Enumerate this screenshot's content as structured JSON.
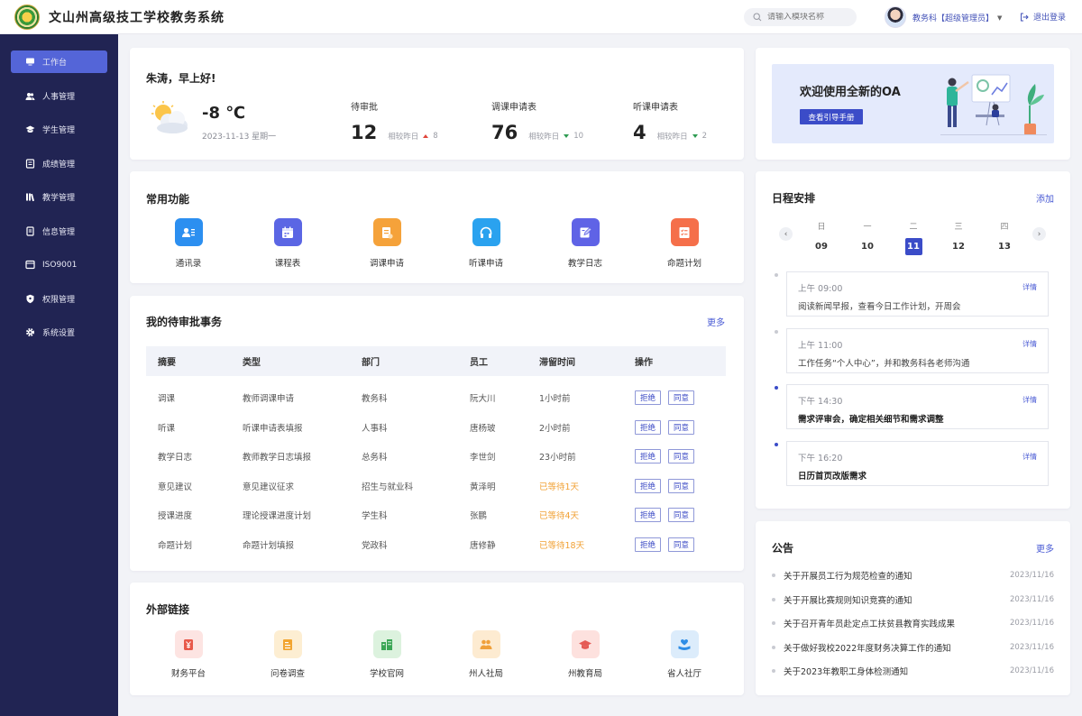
{
  "header": {
    "title": "文山州高级技工学校教务系统",
    "search_placeholder": "请输入模块名称",
    "user": "教务科【超级管理员】",
    "logout": "退出登录"
  },
  "sidebar": {
    "items": [
      {
        "label": "工作台",
        "icon": "monitor-icon"
      },
      {
        "label": "人事管理",
        "icon": "users-icon"
      },
      {
        "label": "学生管理",
        "icon": "graduation-cap-icon"
      },
      {
        "label": "成绩管理",
        "icon": "scores-icon"
      },
      {
        "label": "教学管理",
        "icon": "books-icon"
      },
      {
        "label": "信息管理",
        "icon": "document-icon"
      },
      {
        "label": "ISO9001",
        "icon": "iso-icon"
      },
      {
        "label": "权限管理",
        "icon": "shield-icon"
      },
      {
        "label": "系统设置",
        "icon": "gear-icon"
      }
    ]
  },
  "greeting": {
    "text": "朱涛，早上好!",
    "temp": "-8 ℃",
    "date": "2023-11-13 星期一",
    "weather_icon": "sun-cloud-icon"
  },
  "stats": [
    {
      "label": "待审批",
      "value": "12",
      "cmp": "相较昨日",
      "trend": "up",
      "delta": "8"
    },
    {
      "label": "调课申请表",
      "value": "76",
      "cmp": "相较昨日",
      "trend": "down",
      "delta": "10"
    },
    {
      "label": "听课申请表",
      "value": "4",
      "cmp": "相较昨日",
      "trend": "down",
      "delta": "2"
    }
  ],
  "banner": {
    "title": "欢迎使用全新的OA",
    "button": "查看引导手册"
  },
  "functions": {
    "title": "常用功能",
    "items": [
      {
        "label": "通讯录",
        "icon": "contacts-icon",
        "color": "#2c8ff0"
      },
      {
        "label": "课程表",
        "icon": "calendar-icon",
        "color": "#5b66e4"
      },
      {
        "label": "调课申请",
        "icon": "form-icon",
        "color": "#f5a23a"
      },
      {
        "label": "听课申请",
        "icon": "headphones-icon",
        "color": "#2aa2ef"
      },
      {
        "label": "教学日志",
        "icon": "edit-icon",
        "color": "#5f63e6"
      },
      {
        "label": "命题计划",
        "icon": "checklist-icon",
        "color": "#f56f4a"
      }
    ]
  },
  "approvals": {
    "title": "我的待审批事务",
    "more": "更多",
    "columns": [
      "摘要",
      "类型",
      "部门",
      "员工",
      "滞留时间",
      "操作"
    ],
    "reject": "拒绝",
    "approve": "同意",
    "rows": [
      {
        "summary": "调课",
        "type": "教师调课申请",
        "dept": "教务科",
        "staff": "阮大川",
        "stay": "1小时前",
        "warn": false
      },
      {
        "summary": "听课",
        "type": "听课申请表填报",
        "dept": "人事科",
        "staff": "唐杨玻",
        "stay": "2小时前",
        "warn": false
      },
      {
        "summary": "教学日志",
        "type": "教师教学日志填报",
        "dept": "总务科",
        "staff": "李世剑",
        "stay": "23小时前",
        "warn": false
      },
      {
        "summary": "意见建议",
        "type": "意见建议征求",
        "dept": "招生与就业科",
        "staff": "黄泽明",
        "stay": "已等待1天",
        "warn": true
      },
      {
        "summary": "授课进度",
        "type": "理论授课进度计划",
        "dept": "学生科",
        "staff": "张鹏",
        "stay": "已等待4天",
        "warn": true
      },
      {
        "summary": "命题计划",
        "type": "命题计划填报",
        "dept": "党政科",
        "staff": "唐修静",
        "stay": "已等待18天",
        "warn": true
      }
    ]
  },
  "external": {
    "title": "外部链接",
    "items": [
      {
        "label": "财务平台",
        "icon": "yen-icon",
        "color": "#e8594a",
        "bg": "#fde4e2"
      },
      {
        "label": "问卷调查",
        "icon": "survey-icon",
        "color": "#f2a531",
        "bg": "#fdeed2"
      },
      {
        "label": "学校官网",
        "icon": "building-icon",
        "color": "#3aa655",
        "bg": "#dcf2de"
      },
      {
        "label": "州人社局",
        "icon": "people-icon",
        "color": "#f0a03a",
        "bg": "#fdebd1"
      },
      {
        "label": "州教育局",
        "icon": "mortarboard-icon",
        "color": "#e55b55",
        "bg": "#fde1de"
      },
      {
        "label": "省人社厅",
        "icon": "hand-heart-icon",
        "color": "#2e8de6",
        "bg": "#dcecfb"
      }
    ]
  },
  "schedule": {
    "title": "日程安排",
    "add": "添加",
    "days": [
      {
        "wd": "日",
        "num": "09",
        "selected": false
      },
      {
        "wd": "一",
        "num": "10",
        "selected": false
      },
      {
        "wd": "二",
        "num": "11",
        "selected": true
      },
      {
        "wd": "三",
        "num": "12",
        "selected": false
      },
      {
        "wd": "四",
        "num": "13",
        "selected": false
      }
    ],
    "detail": "详情",
    "events": [
      {
        "time": "上午 09:00",
        "text": "阅读新闻早报，查看今日工作计划，开周会",
        "bold": false,
        "dot": "#c9cbd2"
      },
      {
        "time": "上午 11:00",
        "text": "工作任务“个人中心”，并和教务科各老师沟通",
        "bold": false,
        "dot": "#c9cbd2"
      },
      {
        "time": "下午 14:30",
        "text": "需求评审会，确定相关细节和需求调整",
        "bold": true,
        "dot": "#3b4cc8"
      },
      {
        "time": "下午 16:20",
        "text": "日历首页改版需求",
        "bold": true,
        "dot": "#3b4cc8"
      }
    ]
  },
  "notices": {
    "title": "公告",
    "more": "更多",
    "items": [
      {
        "title": "关于开展员工行为规范检查的通知",
        "date": "2023/11/16"
      },
      {
        "title": "关于开展比赛规则知识竞赛的通知",
        "date": "2023/11/16"
      },
      {
        "title": "关于召开青年员赴定点工扶贫县教育实践成果",
        "date": "2023/11/16"
      },
      {
        "title": "关于做好我校2022年度财务决算工作的通知",
        "date": "2023/11/16"
      },
      {
        "title": "关于2023年教职工身体检测通知",
        "date": "2023/11/16"
      }
    ]
  }
}
